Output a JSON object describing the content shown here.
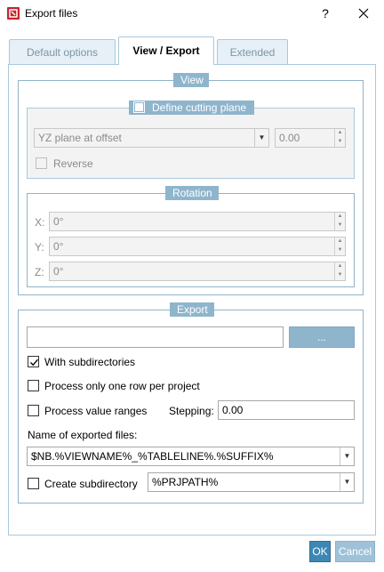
{
  "window": {
    "title": "Export files",
    "help_label": "?",
    "close_label": "✕"
  },
  "tabs": [
    {
      "label": "Default options",
      "active": false
    },
    {
      "label": "View / Export",
      "active": true
    },
    {
      "label": "Extended",
      "active": false
    }
  ],
  "view": {
    "legend": "View",
    "cutting_plane": {
      "legend": "Define cutting plane",
      "checked": false,
      "plane_select": "YZ plane at offset",
      "offset_value": "0.00",
      "reverse_label": "Reverse",
      "reverse_checked": false
    },
    "rotation": {
      "legend": "Rotation",
      "x_label": "X:",
      "x_value": "0°",
      "y_label": "Y:",
      "y_value": "0°",
      "z_label": "Z:",
      "z_value": "0°"
    }
  },
  "export": {
    "legend": "Export",
    "path_value": "",
    "browse_label": "...",
    "with_subdirectories_label": "With subdirectories",
    "with_subdirectories_checked": true,
    "one_row_label": "Process only one row per project",
    "one_row_checked": false,
    "value_ranges_label": "Process value ranges",
    "value_ranges_checked": false,
    "stepping_label": "Stepping:",
    "stepping_value": "0.00",
    "name_label": "Name of exported files:",
    "name_value": "$NB.%VIEWNAME%_%TABLELINE%.%SUFFIX%",
    "create_subdir_label": "Create subdirectory",
    "create_subdir_checked": false,
    "subdir_value": "%PRJPATH%"
  },
  "buttons": {
    "ok_label": "OK",
    "cancel_label": "Cancel"
  },
  "colors": {
    "accent": "#3d87b4",
    "legend_bg": "#8fb5cd",
    "border": "#a9c8dc"
  }
}
